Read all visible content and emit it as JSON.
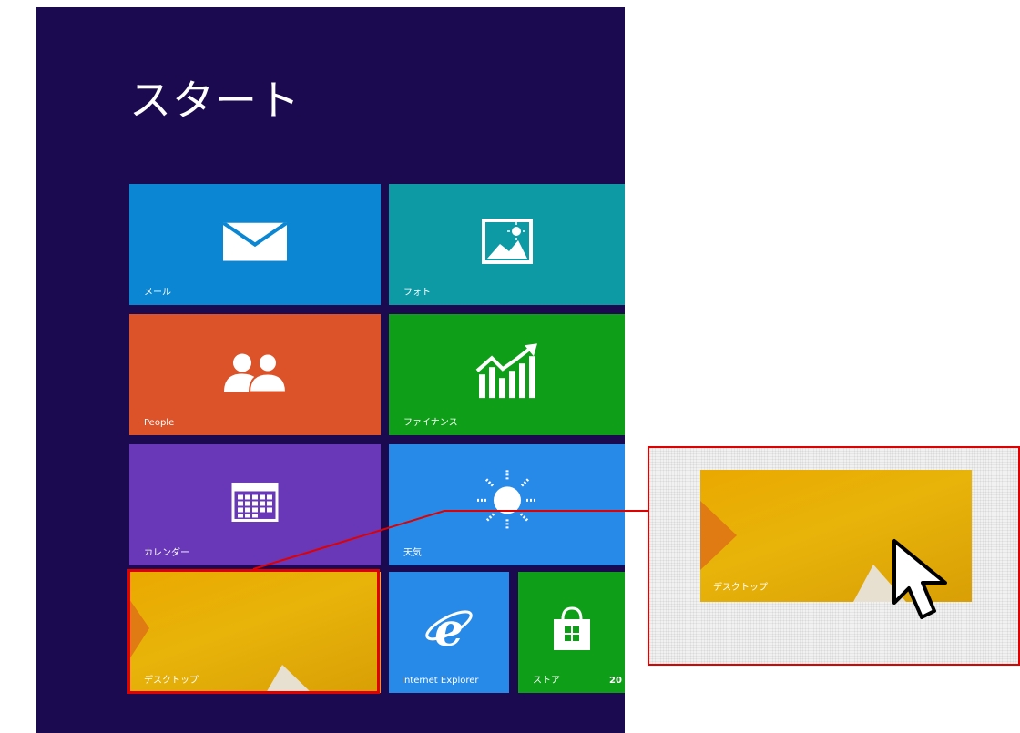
{
  "start_screen": {
    "title": "スタート",
    "background_color": "#1c0a50"
  },
  "tiles": {
    "mail": {
      "label": "メール",
      "color": "#0a86d2",
      "icon": "mail-icon"
    },
    "photos": {
      "label": "フォト",
      "color": "#0e9aa5",
      "icon": "photo-icon"
    },
    "people": {
      "label": "People",
      "color": "#dc5229",
      "icon": "people-icon"
    },
    "finance": {
      "label": "ファイナンス",
      "color": "#0f9e18",
      "icon": "finance-chart-icon"
    },
    "calendar": {
      "label": "カレンダー",
      "color": "#6938b8",
      "icon": "calendar-icon"
    },
    "weather": {
      "label": "天気",
      "color": "#278ae8",
      "icon": "sun-icon"
    },
    "desktop": {
      "label": "デスクトップ",
      "color": "#e8ab06"
    },
    "ie": {
      "label": "Internet Explorer",
      "color": "#278ae8",
      "icon": "internet-explorer-icon"
    },
    "store": {
      "label": "ストア",
      "badge": "20",
      "color": "#0f9e18",
      "icon": "store-bag-icon"
    }
  },
  "zoom_callout": {
    "label": "デスクトップ",
    "border_color": "#e00000",
    "cursor_icon": "mouse-pointer-icon"
  }
}
